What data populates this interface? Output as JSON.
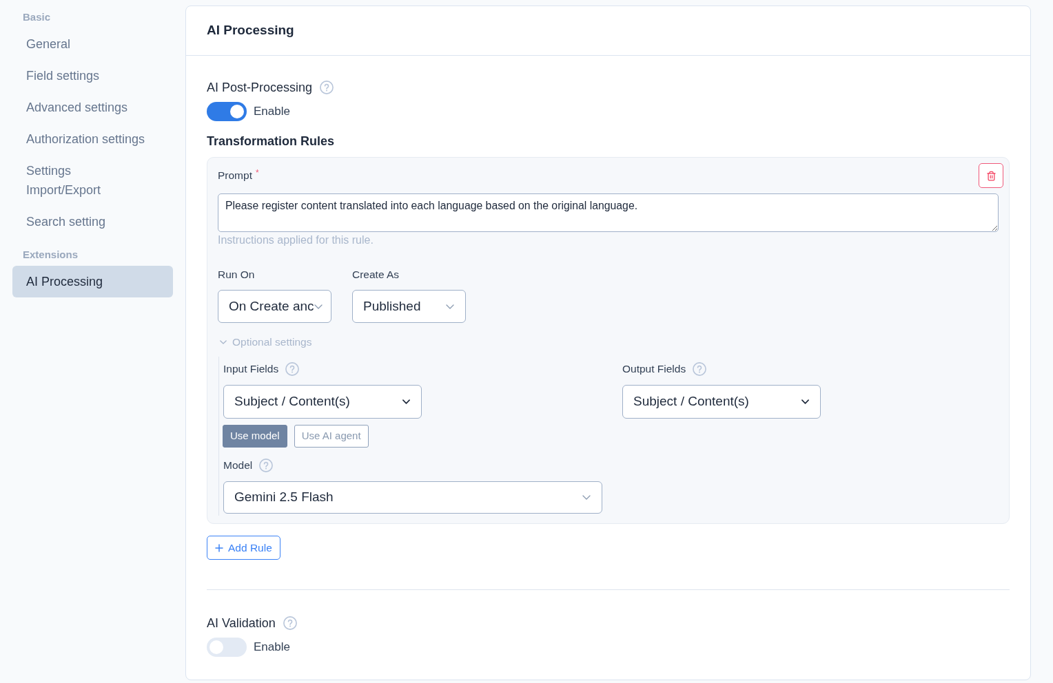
{
  "sidebar": {
    "sections": [
      {
        "title": "Basic",
        "items": [
          {
            "label": "General",
            "selected": false
          },
          {
            "label": "Field settings",
            "selected": false
          },
          {
            "label": "Advanced settings",
            "selected": false
          },
          {
            "label": "Authorization settings",
            "selected": false
          },
          {
            "label": "Settings\nImport/Export",
            "selected": false
          },
          {
            "label": "Search setting",
            "selected": false
          }
        ]
      },
      {
        "title": "Extensions",
        "items": [
          {
            "label": "AI Processing",
            "selected": true
          }
        ]
      }
    ]
  },
  "panel": {
    "title": "AI Processing",
    "post_processing": {
      "label": "AI Post-Processing",
      "toggle": {
        "label": "Enable",
        "on": true
      }
    },
    "rules_heading": "Transformation Rules",
    "rules": [
      {
        "prompt": {
          "label": "Prompt",
          "required_mark": "*",
          "value": "Please register content translated into each language based on the original language.",
          "hint": "Instructions applied for this rule."
        },
        "run_on": {
          "label": "Run On",
          "value": "On Create anc"
        },
        "create_as": {
          "label": "Create As",
          "value": "Published"
        },
        "optional_settings": {
          "label": "Optional settings",
          "expanded": true,
          "input_fields": {
            "label": "Input Fields",
            "value": "Subject / Content(s)"
          },
          "mode_buttons": [
            {
              "label": "Use model",
              "selected": true
            },
            {
              "label": "Use AI agent",
              "selected": false
            }
          ],
          "model": {
            "label": "Model",
            "value": "Gemini 2.5 Flash"
          },
          "output_fields": {
            "label": "Output Fields",
            "value": "Subject / Content(s)"
          }
        }
      }
    ],
    "add_rule": "Add Rule",
    "validation": {
      "label": "AI Validation",
      "toggle": {
        "label": "Enable",
        "on": false
      }
    }
  }
}
